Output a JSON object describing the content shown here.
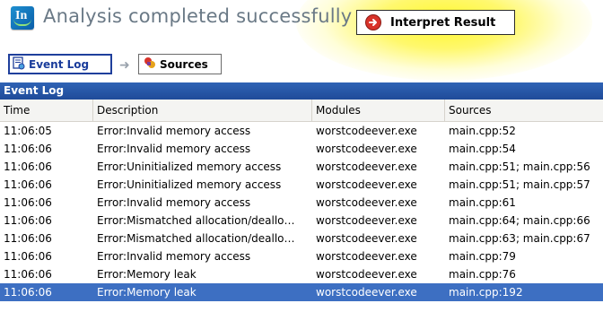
{
  "app": {
    "logo_text": "In",
    "status_title": "Analysis completed successfully",
    "interpret_button_label": "Interpret Result",
    "colors": {
      "title_text": "#6a7986",
      "highlight_glow": "#fff41e",
      "header_blue": "#2f63b5",
      "selected_row": "#3d6fc2",
      "tab_border": "#1f3f9c"
    }
  },
  "tabs": [
    {
      "label": "Event Log",
      "icon": "event-log-icon",
      "active": true
    },
    {
      "label": "Sources",
      "icon": "sources-icon",
      "active": false
    }
  ],
  "panel": {
    "title": "Event Log",
    "columns": [
      "Time",
      "Description",
      "Modules",
      "Sources"
    ],
    "rows": [
      {
        "time": "11:06:05",
        "description": "Error:Invalid memory access",
        "module": "worstcodeever.exe",
        "sources": "main.cpp:52"
      },
      {
        "time": "11:06:06",
        "description": "Error:Invalid memory access",
        "module": "worstcodeever.exe",
        "sources": "main.cpp:54"
      },
      {
        "time": "11:06:06",
        "description": "Error:Uninitialized memory access",
        "module": "worstcodeever.exe",
        "sources": "main.cpp:51; main.cpp:56"
      },
      {
        "time": "11:06:06",
        "description": "Error:Uninitialized memory access",
        "module": "worstcodeever.exe",
        "sources": "main.cpp:51; main.cpp:57"
      },
      {
        "time": "11:06:06",
        "description": "Error:Invalid memory access",
        "module": "worstcodeever.exe",
        "sources": "main.cpp:61"
      },
      {
        "time": "11:06:06",
        "description": "Error:Mismatched allocation/deallo…",
        "module": "worstcodeever.exe",
        "sources": "main.cpp:64; main.cpp:66"
      },
      {
        "time": "11:06:06",
        "description": "Error:Mismatched allocation/deallo…",
        "module": "worstcodeever.exe",
        "sources": "main.cpp:63; main.cpp:67"
      },
      {
        "time": "11:06:06",
        "description": "Error:Invalid memory access",
        "module": "worstcodeever.exe",
        "sources": "main.cpp:79"
      },
      {
        "time": "11:06:06",
        "description": "Error:Memory leak",
        "module": "worstcodeever.exe",
        "sources": "main.cpp:76"
      },
      {
        "time": "11:06:06",
        "description": "Error:Memory leak",
        "module": "worstcodeever.exe",
        "sources": "main.cpp:192",
        "selected": true
      }
    ]
  }
}
